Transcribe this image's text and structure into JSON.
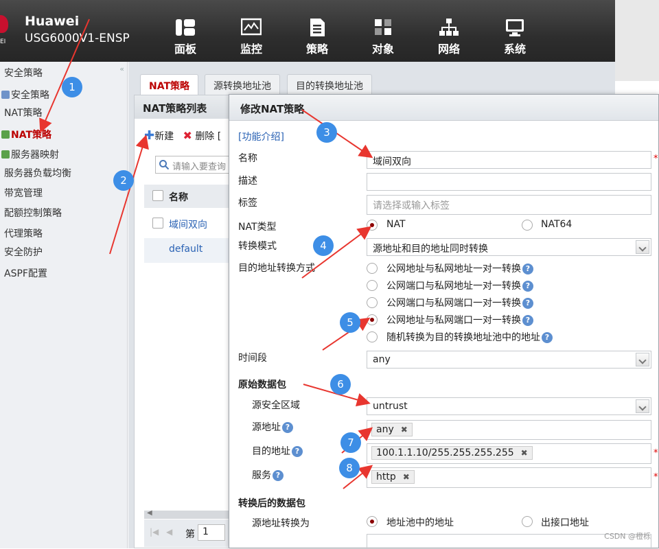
{
  "header": {
    "brand": "Huawei",
    "device": "USG6000V1-ENSP",
    "logo_sub": "EI",
    "nav": [
      {
        "label": "面板",
        "icon": "dashboard-icon"
      },
      {
        "label": "监控",
        "icon": "monitor-icon"
      },
      {
        "label": "策略",
        "icon": "policy-icon"
      },
      {
        "label": "对象",
        "icon": "object-icon"
      },
      {
        "label": "网络",
        "icon": "network-icon"
      },
      {
        "label": "系统",
        "icon": "system-icon"
      }
    ]
  },
  "sidebar": {
    "collapse": "«",
    "items": [
      "安全策略",
      "安全策略",
      "NAT策略",
      "NAT策略",
      "服务器映射",
      "服务器负载均衡",
      "带宽管理",
      "配额控制策略",
      "代理策略",
      "安全防护",
      "ASPF配置"
    ]
  },
  "tabs": [
    "NAT策略",
    "源转换地址池",
    "目的转换地址池"
  ],
  "list_panel": {
    "title": "NAT策略列表",
    "new_label": "新建",
    "delete_label": "删除",
    "more": "[",
    "search_placeholder": "请输入要查询",
    "col_name": "名称",
    "rows": [
      "域间双向",
      "default"
    ],
    "page_label": "第",
    "page_value": "1"
  },
  "dialog": {
    "title": "修改NAT策略",
    "intro_link": "[功能介绍]",
    "name_label": "名称",
    "name_value": "域间双向",
    "desc_label": "描述",
    "tag_label": "标签",
    "tag_placeholder": "请选择或输入标签",
    "nat_type_label": "NAT类型",
    "nat_type_options": [
      "NAT",
      "NAT64"
    ],
    "mode_label": "转换模式",
    "mode_value": "源地址和目的地址同时转换",
    "dst_method_label": "目的地址转换方式",
    "dst_methods": [
      "公网地址与私网地址一对一转换",
      "公网端口与私网地址一对一转换",
      "公网端口与私网端口一对一转换",
      "公网地址与私网端口一对一转换",
      "随机转换为目的转换地址池中的地址"
    ],
    "help_glyph": "?",
    "time_label": "时间段",
    "time_value": "any",
    "orig_section": "原始数据包",
    "src_zone_label": "源安全区域",
    "src_zone_value": "untrust",
    "src_addr_label": "源地址",
    "src_addr_tag": "any",
    "dst_addr_label": "目的地址",
    "dst_addr_tag": "100.1.1.10/255.255.255.255",
    "service_label": "服务",
    "service_tag": "http",
    "remove_glyph": "✖",
    "required_mark": "*",
    "after_section": "转换后的数据包",
    "src_trans_label": "源地址转换为",
    "src_trans_options": [
      "地址池中的地址",
      "出接口地址"
    ]
  },
  "badges": [
    "1",
    "2",
    "3",
    "4",
    "5",
    "6",
    "7",
    "8"
  ],
  "watermark": "CSDN @橙栎",
  "colors": {
    "accent_red": "#b00000",
    "badge_blue": "#3d8ee6",
    "arrow_red": "#e8362f"
  }
}
